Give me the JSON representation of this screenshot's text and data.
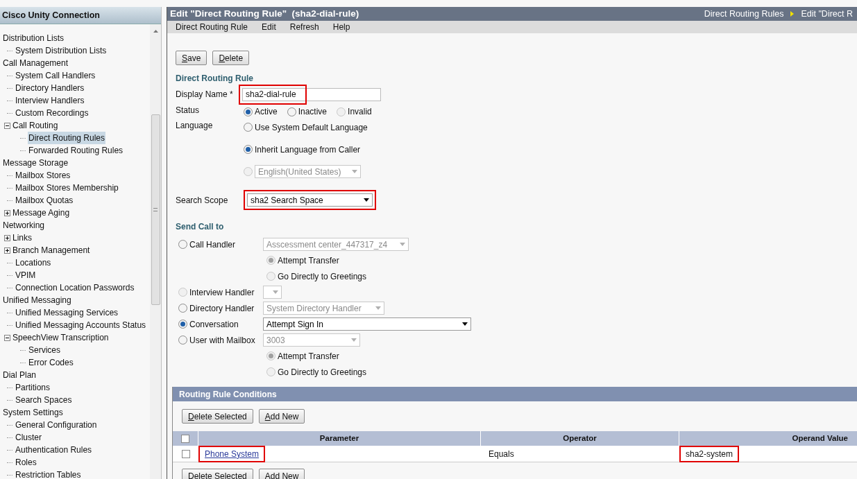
{
  "sidebar": {
    "title": "Cisco Unity Connection",
    "tree": [
      {
        "label": "Distribution Lists",
        "children": [
          {
            "label": "System Distribution Lists"
          }
        ]
      },
      {
        "label": "Call Management",
        "children": [
          {
            "label": "System Call Handlers"
          },
          {
            "label": "Directory Handlers"
          },
          {
            "label": "Interview Handlers"
          },
          {
            "label": "Custom Recordings"
          },
          {
            "label": "Call Routing",
            "expanded": true,
            "children": [
              {
                "label": "Direct Routing Rules",
                "selected": true
              },
              {
                "label": "Forwarded Routing Rules",
                "selected": false
              }
            ]
          }
        ]
      },
      {
        "label": "Message Storage",
        "children": [
          {
            "label": "Mailbox Stores"
          },
          {
            "label": "Mailbox Stores Membership"
          },
          {
            "label": "Mailbox Quotas"
          },
          {
            "label": "Message Aging",
            "expanded": false
          }
        ]
      },
      {
        "label": "Networking",
        "children": [
          {
            "label": "Links",
            "expanded": false
          },
          {
            "label": "Branch Management",
            "expanded": false
          },
          {
            "label": "Locations"
          },
          {
            "label": "VPIM"
          },
          {
            "label": "Connection Location Passwords"
          }
        ]
      },
      {
        "label": "Unified Messaging",
        "children": [
          {
            "label": "Unified Messaging Services"
          },
          {
            "label": "Unified Messaging Accounts Status"
          },
          {
            "label": "SpeechView Transcription",
            "expanded": true,
            "children": [
              {
                "label": "Services"
              },
              {
                "label": "Error Codes"
              }
            ]
          }
        ]
      },
      {
        "label": "Dial Plan",
        "children": [
          {
            "label": "Partitions"
          },
          {
            "label": "Search Spaces"
          }
        ]
      },
      {
        "label": "System Settings",
        "children": [
          {
            "label": "General Configuration"
          },
          {
            "label": "Cluster"
          },
          {
            "label": "Authentication Rules"
          },
          {
            "label": "Roles"
          },
          {
            "label": "Restriction Tables"
          }
        ]
      }
    ]
  },
  "page": {
    "title": "Edit \"Direct Routing Rule\"  (sha2-dial-rule)",
    "breadcrumb": [
      "Direct Routing Rules",
      "Edit \"Direct R"
    ]
  },
  "menu": [
    "Direct Routing Rule",
    "Edit",
    "Refresh",
    "Help"
  ],
  "toolbar": [
    "Save",
    "Delete"
  ],
  "section": "Direct Routing Rule",
  "display_name": {
    "label": "Display Name *",
    "value": "sha2-dial-rule",
    "highlighted": true
  },
  "status": {
    "label": "Status",
    "options": [
      {
        "label": "Active",
        "selected": true,
        "disabled": false
      },
      {
        "label": "Inactive",
        "selected": false,
        "disabled": false
      },
      {
        "label": "Invalid",
        "selected": false,
        "disabled": true
      }
    ]
  },
  "language": {
    "label": "Language",
    "options": [
      {
        "kind": "radio",
        "label": "Use System Default Language",
        "selected": false
      },
      {
        "kind": "radio",
        "label": "Inherit Language from Caller",
        "selected": true
      },
      {
        "kind": "select",
        "value": "English(United States)",
        "selected": false
      }
    ]
  },
  "search_scope": {
    "label": "Search Scope",
    "value": "sha2 Search Space",
    "highlighted": true
  },
  "send_call_to": {
    "heading": "Send Call to",
    "options": [
      {
        "label": "Call Handler",
        "selected": false,
        "disabled": false,
        "select": {
          "value": "Asscessment center_447317_z4",
          "disabled": true
        },
        "sub_options": [
          {
            "label": "Attempt Transfer",
            "selected": true
          },
          {
            "label": "Go Directly to Greetings",
            "selected": false
          }
        ]
      },
      {
        "label": "Interview Handler",
        "selected": false,
        "disabled": true,
        "select": {
          "disabled": true
        }
      },
      {
        "label": "Directory Handler",
        "selected": false,
        "disabled": false,
        "select": {
          "value": "System Directory Handler",
          "disabled": true
        }
      },
      {
        "label": "Conversation",
        "selected": true,
        "disabled": false,
        "select": {
          "value": "Attempt Sign In",
          "disabled": false
        }
      },
      {
        "label": "User with Mailbox",
        "selected": false,
        "disabled": false,
        "select": {
          "value": "3003",
          "disabled": true
        },
        "sub_options": [
          {
            "label": "Attempt Transfer",
            "selected": true
          },
          {
            "label": "Go Directly to Greetings",
            "selected": false
          }
        ]
      }
    ]
  },
  "conditions": {
    "title": "Routing Rule Conditions",
    "buttons": [
      "Delete Selected",
      "Add New"
    ],
    "select_all_checked": false,
    "columns": [
      "Parameter",
      "Operator",
      "Operand Value"
    ],
    "rows": [
      {
        "checked": false,
        "cells": [
          {
            "kind": "link",
            "text": "Phone System",
            "highlighted": true
          },
          {
            "kind": "text",
            "text": "Equals",
            "highlighted": false
          },
          {
            "kind": "text",
            "text": "sha2-system",
            "highlighted": true
          }
        ]
      }
    ],
    "bottom_buttons": [
      "Delete Selected",
      "Add New"
    ]
  }
}
